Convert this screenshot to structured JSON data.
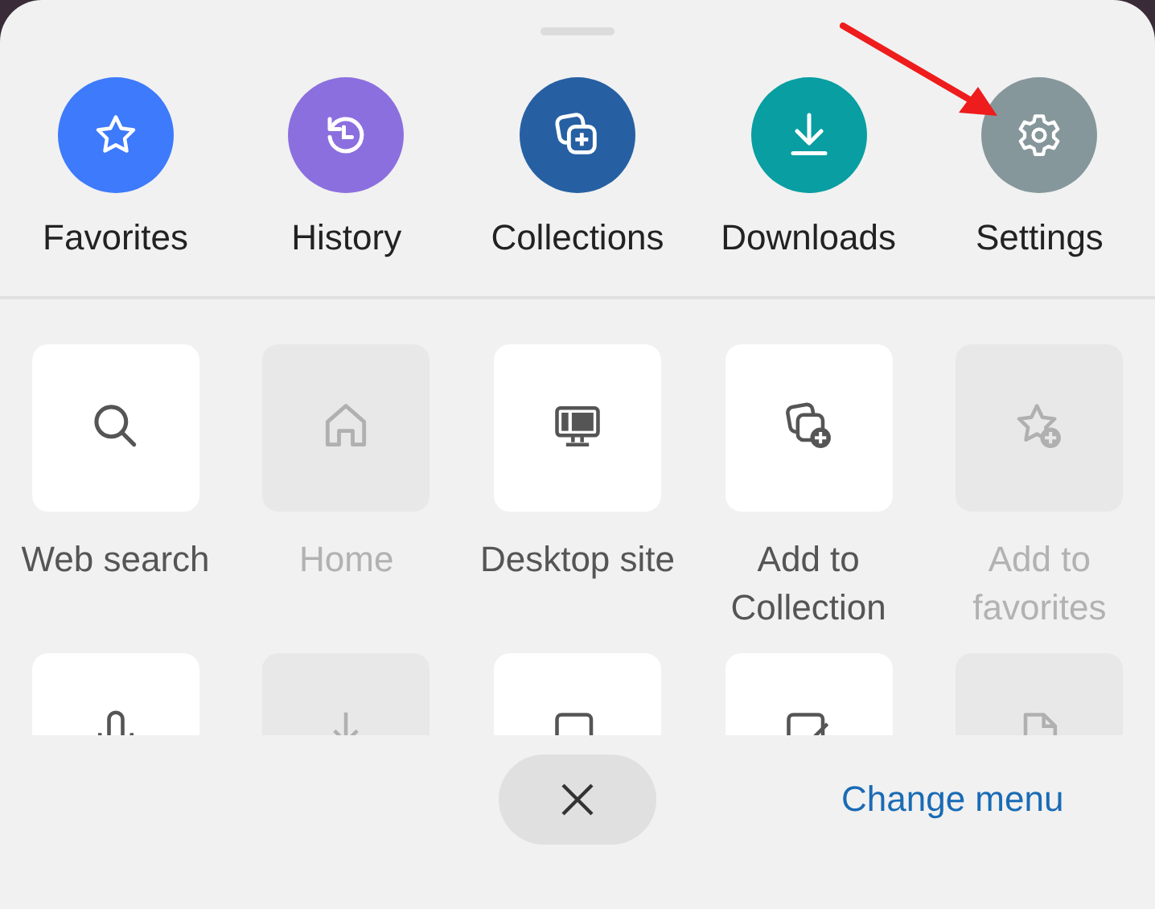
{
  "shortcuts": [
    {
      "label": "Favorites",
      "color": "#3d7afc"
    },
    {
      "label": "History",
      "color": "#8c6fdf"
    },
    {
      "label": "Collections",
      "color": "#2660a3"
    },
    {
      "label": "Downloads",
      "color": "#089ea2"
    },
    {
      "label": "Settings",
      "color": "#86979b"
    }
  ],
  "tools": [
    {
      "label": "Web search",
      "disabled": false
    },
    {
      "label": "Home",
      "disabled": true
    },
    {
      "label": "Desktop site",
      "disabled": false
    },
    {
      "label": "Add to Collection",
      "disabled": false
    },
    {
      "label": "Add to favorites",
      "disabled": true
    },
    {
      "disabled": false
    },
    {
      "disabled": true
    },
    {
      "disabled": false
    },
    {
      "disabled": false
    },
    {
      "disabled": true
    }
  ],
  "change_menu": "Change menu"
}
